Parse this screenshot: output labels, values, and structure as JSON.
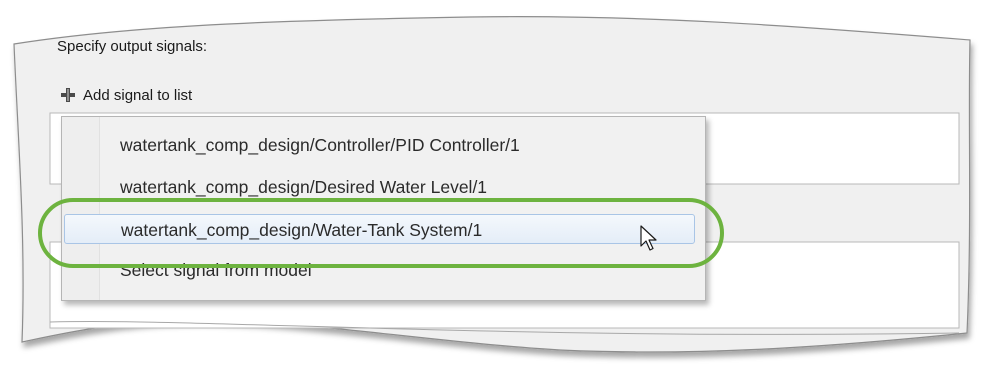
{
  "panel": {
    "title": "Specify output signals:",
    "add_signal_label": "Add signal to list"
  },
  "icons": {
    "add": "plus-icon",
    "pointer": "mouse-pointer-icon"
  },
  "dropdown": {
    "items": [
      "watertank_comp_design/Controller/PID Controller/1",
      "watertank_comp_design/Desired  Water Level/1",
      "watertank_comp_design/Water-Tank System/1",
      "Select signal from model"
    ],
    "highlighted_item": "watertank_comp_design/Water-Tank System/1"
  },
  "colors": {
    "highlight_oval": "#6db33f",
    "selection_fill": "#e4edf8",
    "selection_border": "#a9c5e6"
  }
}
